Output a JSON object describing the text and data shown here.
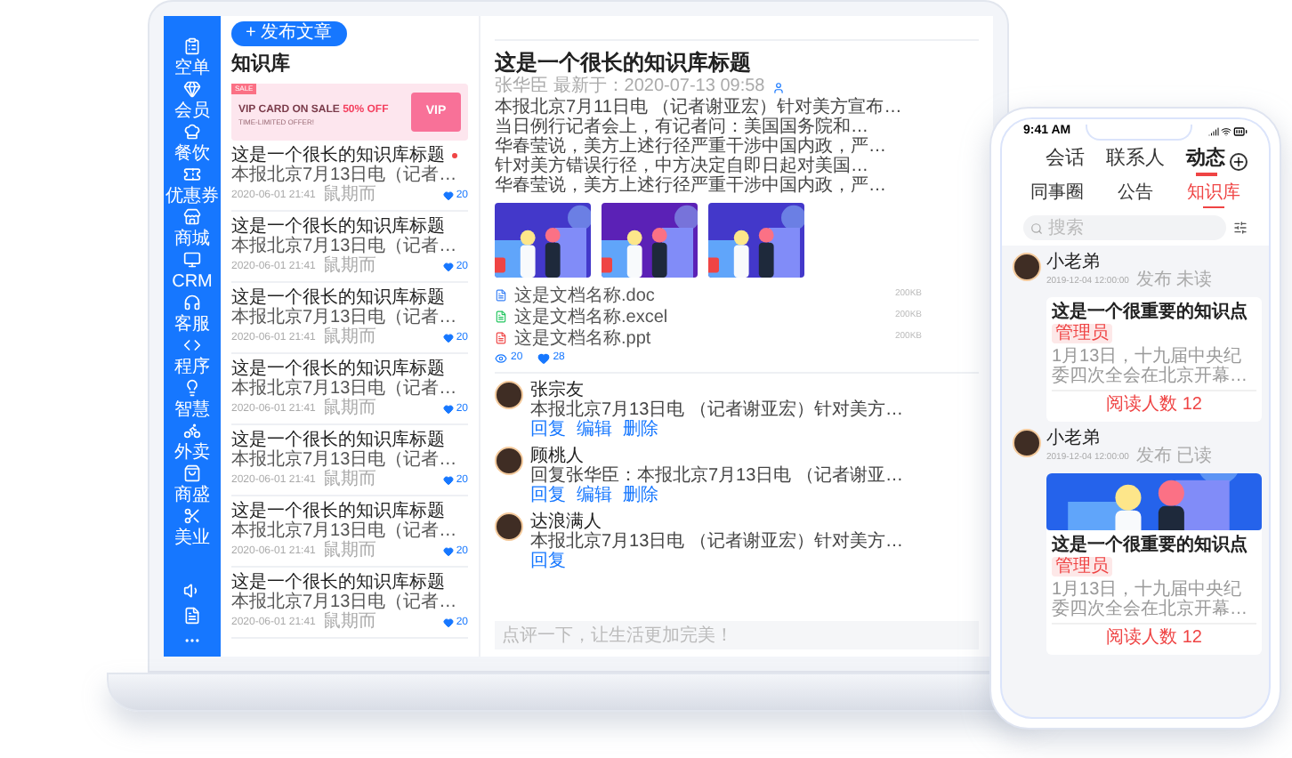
{
  "laptop": {
    "nav": [
      {
        "label": "空单"
      },
      {
        "label": "会员"
      },
      {
        "label": "餐饮"
      },
      {
        "label": "优惠券"
      },
      {
        "label": "商城"
      },
      {
        "label": "CRM"
      },
      {
        "label": "客服"
      },
      {
        "label": "程序"
      },
      {
        "label": "智慧"
      },
      {
        "label": "外卖"
      },
      {
        "label": "商盛"
      },
      {
        "label": "美业"
      }
    ],
    "publish_button": "+ 发布文章",
    "list_title": "知识库",
    "banner": {
      "tag": "SALE",
      "headline": "VIP CARD ON SALE",
      "discount": "50% OFF",
      "subline": "TIME-LIMITED OFFER!",
      "card": "VIP"
    },
    "articles": [
      {
        "title": "这是一个很长的知识库标题",
        "excerpt": "本报北京7月13日电（记者…",
        "date": "2020-06-01 21:41",
        "author": "鼠期而",
        "likes": "20",
        "unread": true
      },
      {
        "title": "这是一个很长的知识库标题",
        "excerpt": "本报北京7月13日电（记者…",
        "date": "2020-06-01 21:41",
        "author": "鼠期而",
        "likes": "20",
        "unread": false
      },
      {
        "title": "这是一个很长的知识库标题",
        "excerpt": "本报北京7月13日电（记者…",
        "date": "2020-06-01 21:41",
        "author": "鼠期而",
        "likes": "20",
        "unread": false
      },
      {
        "title": "这是一个很长的知识库标题",
        "excerpt": "本报北京7月13日电（记者…",
        "date": "2020-06-01 21:41",
        "author": "鼠期而",
        "likes": "20",
        "unread": false
      },
      {
        "title": "这是一个很长的知识库标题",
        "excerpt": "本报北京7月13日电（记者…",
        "date": "2020-06-01 21:41",
        "author": "鼠期而",
        "likes": "20",
        "unread": false
      },
      {
        "title": "这是一个很长的知识库标题",
        "excerpt": "本报北京7月13日电（记者…",
        "date": "2020-06-01 21:41",
        "author": "鼠期而",
        "likes": "20",
        "unread": false
      },
      {
        "title": "这是一个很长的知识库标题",
        "excerpt": "本报北京7月13日电（记者…",
        "date": "2020-06-01 21:41",
        "author": "鼠期而",
        "likes": "20",
        "unread": false
      }
    ],
    "article": {
      "title": "这是一个很长的知识库标题",
      "meta": "张华臣 最新于：2020-07-13 09:58",
      "paragraphs": [
        "本报北京7月11日电 （记者谢亚宏）针对美方宣布…",
        "当日例行记者会上，有记者问：美国国务院和…",
        "华春莹说，美方上述行径严重干涉中国内政，严…",
        "针对美方错误行径，中方决定自即日起对美国…",
        "华春莹说，美方上述行径严重干涉中国内政，严…"
      ],
      "attachments": [
        {
          "name": "这是文档名称.doc",
          "size": "200KB",
          "kind": "doc"
        },
        {
          "name": "这是文档名称.excel",
          "size": "200KB",
          "kind": "excel"
        },
        {
          "name": "这是文档名称.ppt",
          "size": "200KB",
          "kind": "ppt"
        }
      ],
      "views": "20",
      "likes": "28",
      "comments": [
        {
          "name": "张宗友",
          "text": "本报北京7月13日电 （记者谢亚宏）针对美方…",
          "actions": [
            "回复",
            "编辑",
            "删除"
          ]
        },
        {
          "name": "顾桃人",
          "text": "回复张华臣：本报北京7月13日电 （记者谢亚…",
          "actions": [
            "回复",
            "编辑",
            "删除"
          ]
        },
        {
          "name": "达浪满人",
          "text": "本报北京7月13日电 （记者谢亚宏）针对美方…",
          "actions": [
            "回复"
          ]
        }
      ],
      "comment_placeholder": "点评一下，让生活更加完美！"
    }
  },
  "phone": {
    "time": "9:41 AM",
    "tabs": [
      {
        "label": "会话",
        "selected": false
      },
      {
        "label": "联系人",
        "selected": false
      },
      {
        "label": "动态",
        "selected": true
      }
    ],
    "subtabs": [
      {
        "label": "同事圈",
        "selected": false
      },
      {
        "label": "公告",
        "selected": false
      },
      {
        "label": "知识库",
        "selected": true
      }
    ],
    "search_placeholder": "搜索",
    "posts": [
      {
        "author": "小老弟",
        "date": "2019-12-04 12:00:00",
        "status": "发布 未读",
        "card": {
          "title": "这是一个很重要的知识点",
          "badge": "管理员",
          "text": "1月13日，十九届中央纪委四次全会在北京开幕…",
          "reads": "阅读人数 12",
          "kind": "text"
        }
      },
      {
        "author": "小老弟",
        "date": "2019-12-04 12:00:00",
        "status": "发布 已读",
        "card": {
          "title": "这是一个很重要的知识点",
          "badge": "管理员",
          "text": "1月13日，十九届中央纪委四次全会在北京开幕…",
          "reads": "阅读人数 12",
          "kind": "picture"
        }
      }
    ]
  }
}
